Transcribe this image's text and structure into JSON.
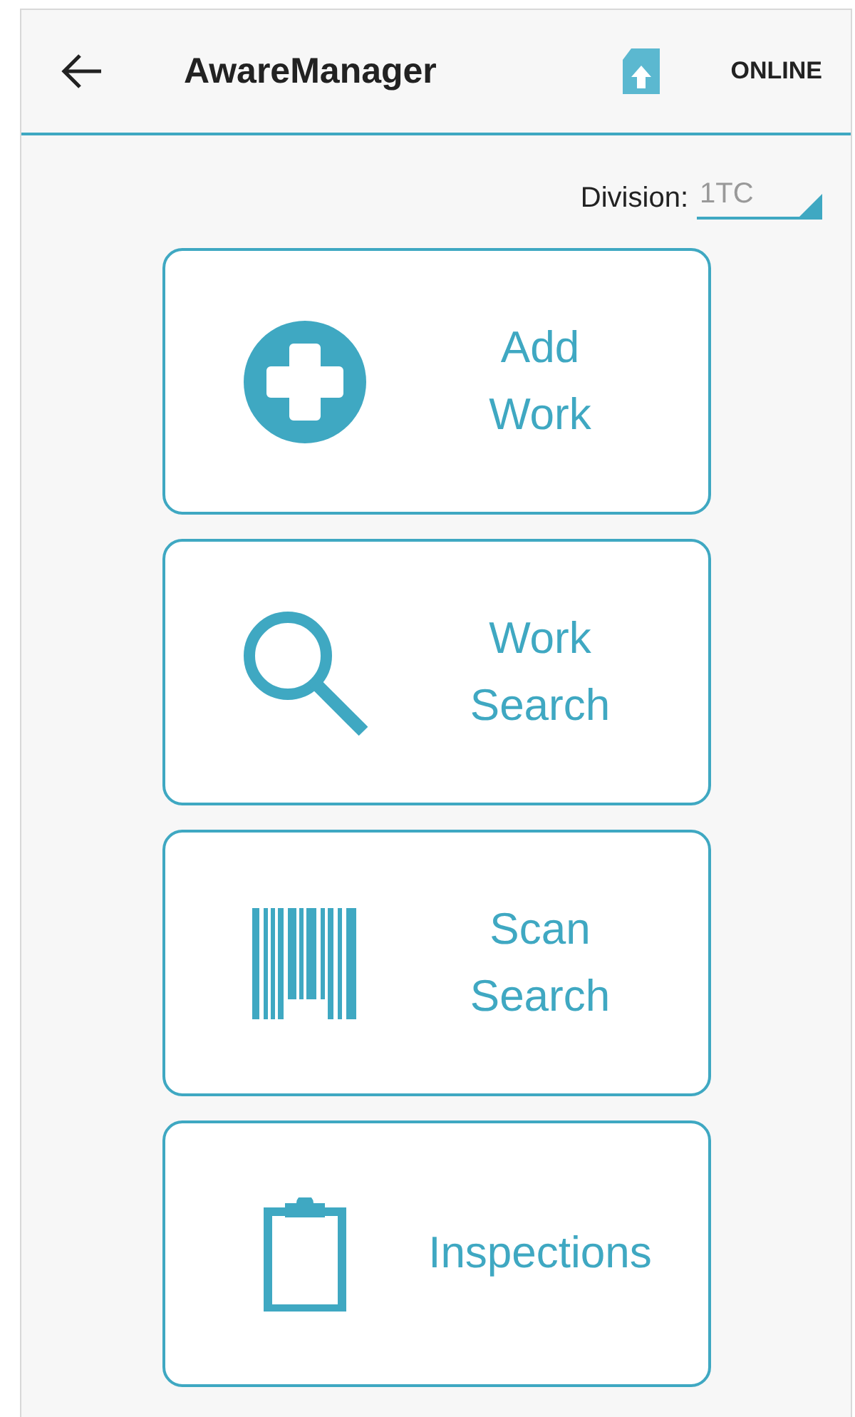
{
  "header": {
    "title": "AwareManager",
    "status": "ONLINE"
  },
  "division": {
    "label": "Division:",
    "value": "1TC"
  },
  "tiles": [
    {
      "kind": "add",
      "label": "Add Work"
    },
    {
      "kind": "search",
      "label": "Work Search"
    },
    {
      "kind": "barcode",
      "label": "Scan Search"
    },
    {
      "kind": "clipboard",
      "label": "Inspections"
    }
  ]
}
